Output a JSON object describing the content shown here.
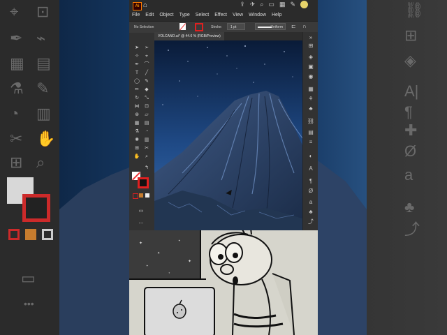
{
  "app": {
    "logo_text": "Ai",
    "menus": [
      "File",
      "Edit",
      "Object",
      "Type",
      "Select",
      "Effect",
      "View",
      "Window",
      "Help"
    ]
  },
  "control_bar": {
    "selection_label": "No Selection",
    "stroke_label": "Stroke:",
    "stroke_value": "1 pt",
    "profile_label": "Uniform"
  },
  "document": {
    "tab_title": "VOLCANO.ai* @ 44.6 % (RGB/Preview)"
  },
  "colors": {
    "accent_stroke": "#e02020",
    "app_bg": "#323232",
    "sky_top": "#0b1e3d",
    "mountain": "#2d4366"
  },
  "tools": [
    "selection-tool",
    "direct-selection-tool",
    "pen-tool",
    "curvature-tool",
    "type-tool",
    "line-tool",
    "rectangle-tool",
    "paintbrush-tool",
    "pencil-tool",
    "eraser-tool",
    "rotate-tool",
    "scale-tool",
    "width-tool",
    "free-transform-tool",
    "shape-builder-tool",
    "perspective-tool",
    "mesh-tool",
    "gradient-tool",
    "eyedropper-tool",
    "blend-tool",
    "symbol-sprayer-tool",
    "graph-tool",
    "artboard-tool",
    "slice-tool",
    "hand-tool",
    "zoom-tool"
  ],
  "panel_icons": [
    "properties-icon",
    "layers-icon",
    "libraries-icon",
    "color-icon",
    "swatches-icon",
    "brushes-icon",
    "symbols-icon",
    "graphic-styles-icon",
    "appearance-icon",
    "transparency-icon",
    "stroke-icon",
    "gradient-icon",
    "character-icon",
    "paragraph-icon",
    "opentype-icon",
    "glyphs-icon",
    "align-icon",
    "pathfinder-icon",
    "transform-icon"
  ]
}
